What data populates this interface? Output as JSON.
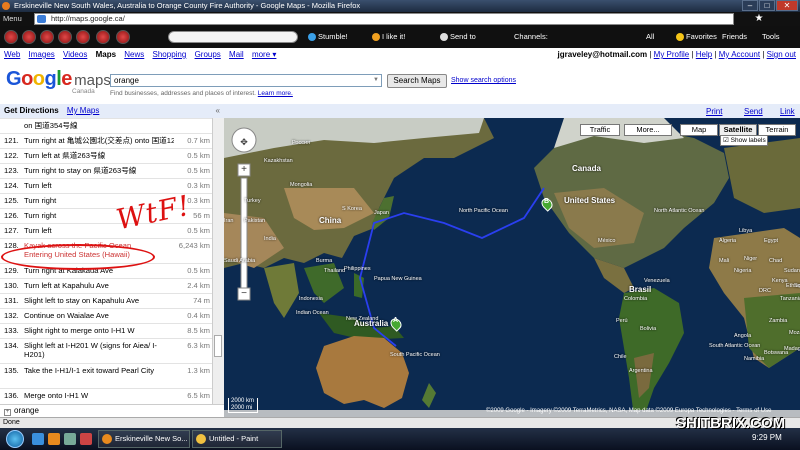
{
  "browser": {
    "window_title": "Erskineville New South Wales, Australia to Orange County Fire Authority - Google Maps - Mozilla Firefox",
    "menu_label": "Menu",
    "url": "http://maps.google.ca/",
    "toolbar": {
      "stumble_label": "Stumble!",
      "like_label": "I like it!",
      "send_to_label": "Send to",
      "channels_label": "Channels:",
      "all_label": "All",
      "favorites_label": "Favorites",
      "friends_label": "Friends",
      "tools_label": "Tools"
    },
    "status": "Done"
  },
  "google_bar": {
    "links": [
      "Web",
      "Images",
      "Videos",
      "Maps",
      "News",
      "Shopping",
      "Groups",
      "Mail",
      "more ▾"
    ],
    "selected": "Maps",
    "user_email": "jgraveley@hotmail.com",
    "user_links": [
      "My Profile",
      "Help",
      "My Account",
      "Sign out"
    ]
  },
  "search": {
    "logo_text": "Google",
    "logo_maps": "maps",
    "logo_sub": "Canada",
    "query": "orange",
    "button_label": "Search Maps",
    "options_link": "Show search options",
    "hint_text": "Find businesses, addresses and places of interest.",
    "hint_link": "Learn more."
  },
  "left_panel": {
    "header_title": "Get Directions",
    "header_link": "My Maps",
    "collapse_icon": "«",
    "bottom_query": "orange"
  },
  "map_header": {
    "print_label": "Print",
    "send_label": "Send",
    "link_label": "Link"
  },
  "directions": [
    {
      "n": "",
      "text": "on 国道354号線",
      "dist": ""
    },
    {
      "n": "121.",
      "text": "Turn right at 亀城公園北(交差点) onto 国道125号線",
      "dist": "0.7 km"
    },
    {
      "n": "122.",
      "text": "Turn left at 県道263号線",
      "dist": "0.5 km"
    },
    {
      "n": "123.",
      "text": "Turn right to stay on 県道263号線",
      "dist": "0.5 km"
    },
    {
      "n": "124.",
      "text": "Turn left",
      "dist": "0.3 km"
    },
    {
      "n": "125.",
      "text": "Turn right",
      "dist": "0.3 km"
    },
    {
      "n": "126.",
      "text": "Turn right",
      "dist": "56 m"
    },
    {
      "n": "127.",
      "text": "Turn left",
      "dist": "0.5 km"
    },
    {
      "n": "128.",
      "text": "Kayak across the Pacific Ocean",
      "sub": "Entering United States (Hawaii)",
      "dist": "6,243 km"
    },
    {
      "n": "129.",
      "text": "Turn right at Kalakaua Ave",
      "dist": "0.5 km"
    },
    {
      "n": "130.",
      "text": "Turn left at Kapahulu Ave",
      "dist": "2.4 km"
    },
    {
      "n": "131.",
      "text": "Slight left to stay on Kapahulu Ave",
      "dist": "74 m"
    },
    {
      "n": "132.",
      "text": "Continue on Waialae Ave",
      "dist": "0.4 km"
    },
    {
      "n": "133.",
      "text": "Slight right to merge onto I-H1 W",
      "dist": "8.5 km"
    },
    {
      "n": "134.",
      "text": "Slight left at I-H201 W (signs for Aiea/ I-H201)",
      "dist": "6.3 km"
    },
    {
      "n": "135.",
      "text": "Take the I-H1/I-1 exit toward Pearl City",
      "dist": "1.3 km"
    },
    {
      "n": "136.",
      "text": "Merge onto I-H1 W",
      "dist": "6.5 km"
    }
  ],
  "annotation": {
    "scribble": "WtF!"
  },
  "map": {
    "buttons": [
      "Traffic",
      "More...",
      "Map",
      "Satellite",
      "Terrain"
    ],
    "selected_button": "Satellite",
    "show_labels": "Show labels",
    "labels": [
      "Россия",
      "Canada",
      "United States",
      "Mongolia",
      "China",
      "S Korea",
      "Japan",
      "North Pacific Ocean",
      "Philippines",
      "Papua New Guinea",
      "Indonesia",
      "Australia",
      "New Zealand",
      "South Pacific Ocean",
      "Indian Ocean",
      "North Atlantic Ocean",
      "South Atlantic Ocean",
      "Brasil",
      "Perú",
      "Bolivia",
      "Argentina",
      "Chile",
      "México",
      "Venezuela",
      "Colombia",
      "Mali",
      "Niger",
      "Chad",
      "Sudan",
      "DRC",
      "Angola",
      "Namibia",
      "Tanzania",
      "Kenya",
      "Ethiopia",
      "Somalia",
      "Kazakhstan",
      "India",
      "Pakistan",
      "Iran",
      "Saudi Arabia",
      "Turkey",
      "Egypt",
      "Libya",
      "Algeria",
      "Madagascar",
      "Mozambique",
      "Zambia",
      "Botswana",
      "Nigeria",
      "Burma",
      "Thailand"
    ],
    "scale": [
      "2000 km",
      "2000 mi"
    ],
    "copyright": "©2009 Google - Imagery ©2009 TerraMetrics, NASA, Map data ©2009 Europa Technologies - Terms of Use",
    "marker_a": "A",
    "marker_b": "B"
  },
  "taskbar": {
    "tasks": [
      "Erskineville New So...",
      "Untitled - Paint"
    ],
    "watermark": "SHITBRIX.COM",
    "clock": "9:29 PM"
  },
  "colors": {
    "route": "#2a3ff0",
    "annotation": "#dd1111",
    "link": "#0000cc"
  }
}
